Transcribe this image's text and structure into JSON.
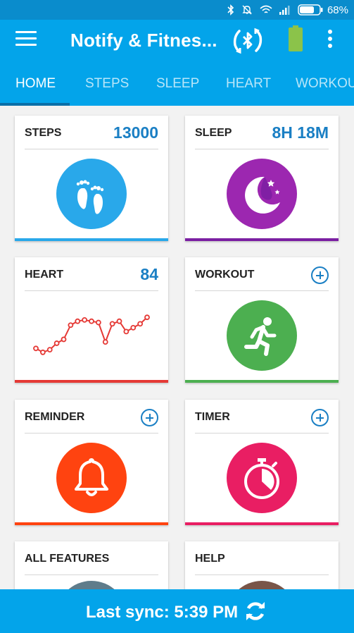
{
  "status_bar": {
    "battery_text": "68%",
    "icons": [
      "bluetooth-icon",
      "mute-icon",
      "wifi-icon",
      "signal-icon",
      "battery-icon"
    ]
  },
  "app_bar": {
    "title": "Notify & Fitnes...",
    "icons": [
      "menu-icon",
      "bluetooth-sync-icon",
      "phone-battery-icon",
      "overflow-menu-icon"
    ]
  },
  "tabs": [
    {
      "label": "HOME",
      "active": true
    },
    {
      "label": "STEPS",
      "active": false
    },
    {
      "label": "SLEEP",
      "active": false
    },
    {
      "label": "HEART",
      "active": false
    },
    {
      "label": "WORKOUT",
      "active": false
    }
  ],
  "cards": {
    "steps": {
      "label": "STEPS",
      "value": "13000",
      "icon": "footprints-icon",
      "color": "#29a8ea"
    },
    "sleep": {
      "label": "SLEEP",
      "value": "8H 18M",
      "icon": "moon-stars-icon",
      "color": "#9c27b0"
    },
    "heart": {
      "label": "HEART",
      "value": "84",
      "icon": "heart-rate-chart",
      "color": "#e53935"
    },
    "workout": {
      "label": "WORKOUT",
      "icon": "running-person-icon",
      "color": "#4caf50"
    },
    "reminder": {
      "label": "REMINDER",
      "icon": "bell-icon",
      "color": "#ff4310"
    },
    "timer": {
      "label": "TIMER",
      "icon": "stopwatch-icon",
      "color": "#e91e63"
    },
    "all_features": {
      "label": "ALL FEATURES",
      "icon": "features-icon",
      "color": "#5f7c8b"
    },
    "help": {
      "label": "HELP",
      "icon": "help-icon",
      "color": "#795548"
    }
  },
  "heart_sparkline": [
    43,
    40,
    42,
    47,
    50,
    61,
    64,
    65,
    64,
    63,
    48,
    62,
    64,
    56,
    59,
    62,
    67
  ],
  "bottom_bar": {
    "sync_text": "Last sync: 5:39 PM",
    "icon": "refresh-icon"
  }
}
